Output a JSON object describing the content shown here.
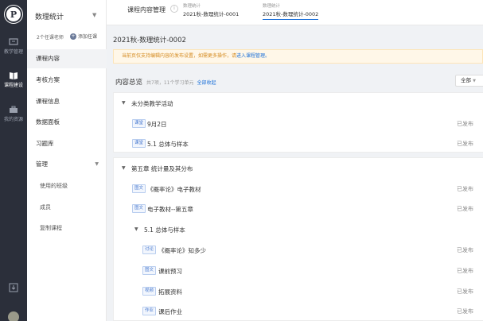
{
  "rail": {
    "logo_text": "P",
    "nav": [
      {
        "label": "教学管理",
        "icon": "book-desk-icon"
      },
      {
        "label": "课程建设",
        "icon": "open-book-icon"
      },
      {
        "label": "我的资源",
        "icon": "briefcase-icon"
      }
    ]
  },
  "sidebar": {
    "course_title": "数理统计",
    "teachers": "2个任课老师",
    "add_teacher": "添加任课",
    "items": [
      {
        "label": "课程内容"
      },
      {
        "label": "考核方案"
      },
      {
        "label": "课程信息"
      },
      {
        "label": "数据面板"
      },
      {
        "label": "习题库"
      },
      {
        "label": "管理"
      }
    ],
    "sub_items": [
      {
        "label": "使用的班级"
      },
      {
        "label": "成员"
      },
      {
        "label": "复制课程"
      }
    ]
  },
  "topbar": {
    "crumb0": "课程内容管理",
    "tabs": [
      {
        "small": "数理统计",
        "main": "2021秋-数理统计-0001"
      },
      {
        "small": "数理统计",
        "main": "2021秋-数理统计-0002"
      }
    ]
  },
  "main": {
    "heading": "2021秋-数理统计-0002",
    "notice_text": "当前页仅支持编辑内容的发布设置，如需更多操作，请",
    "notice_link": "进入课程管理。",
    "summary_title": "内容总览",
    "summary_count": "共7项，11个学习单元",
    "expand_all": "全部收起",
    "filter_value": "全部"
  },
  "groups": [
    {
      "title": "未分类教学活动",
      "items": [
        {
          "tag": "课堂",
          "title": "9月2日",
          "status": "已发布"
        },
        {
          "tag": "课堂",
          "title": "5.1 总体与样本",
          "status": "已发布"
        }
      ]
    },
    {
      "title": "第五章 统计量及其分布",
      "items": [
        {
          "tag": "图文",
          "title": "《概率论》电子教材",
          "status": "已发布"
        },
        {
          "tag": "图文",
          "title": "电子教材--第五章",
          "status": "已发布"
        }
      ],
      "subgroup": {
        "title": "5.1 总体与样本",
        "items": [
          {
            "tag": "讨论",
            "title": "《概率论》知多少",
            "status": "已发布"
          },
          {
            "tag": "图文",
            "title": "课前预习",
            "status": "已发布"
          },
          {
            "tag": "视频",
            "title": "拓展资料",
            "status": "已发布"
          },
          {
            "tag": "作业",
            "title": "课后作业",
            "status": "已发布"
          }
        ]
      }
    }
  ]
}
